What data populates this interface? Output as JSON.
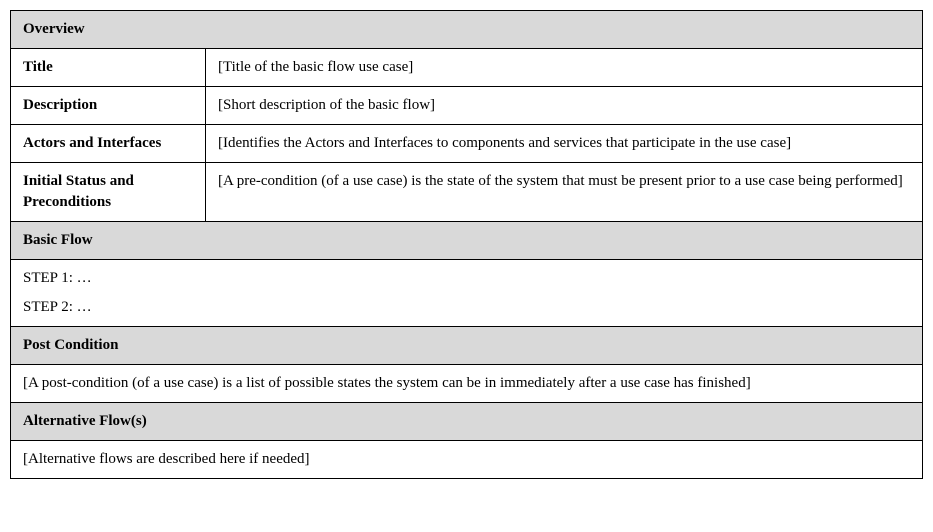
{
  "sections": {
    "overview": {
      "header": "Overview",
      "rows": {
        "title": {
          "label": "Title",
          "value": "[Title of the basic flow use case]"
        },
        "description": {
          "label": "Description",
          "value": "[Short description of the basic flow]"
        },
        "actors": {
          "label": "Actors and Interfaces",
          "value": "[Identifies the Actors and Interfaces to components and services that participate in the use case]"
        },
        "initial": {
          "label": "Initial Status and Preconditions",
          "value": "[A pre-condition (of a use case) is the state of the system that must be present prior to a use case being performed]"
        }
      }
    },
    "basic_flow": {
      "header": "Basic Flow",
      "steps": {
        "step1": "STEP 1: …",
        "step2": "STEP 2: …"
      }
    },
    "post_condition": {
      "header": "Post Condition",
      "value": "[A post-condition (of a use case) is a list of possible states the system can be in immediately after a use case has finished]"
    },
    "alternative_flows": {
      "header": "Alternative Flow(s)",
      "value": "[Alternative flows are described here if needed]"
    }
  }
}
